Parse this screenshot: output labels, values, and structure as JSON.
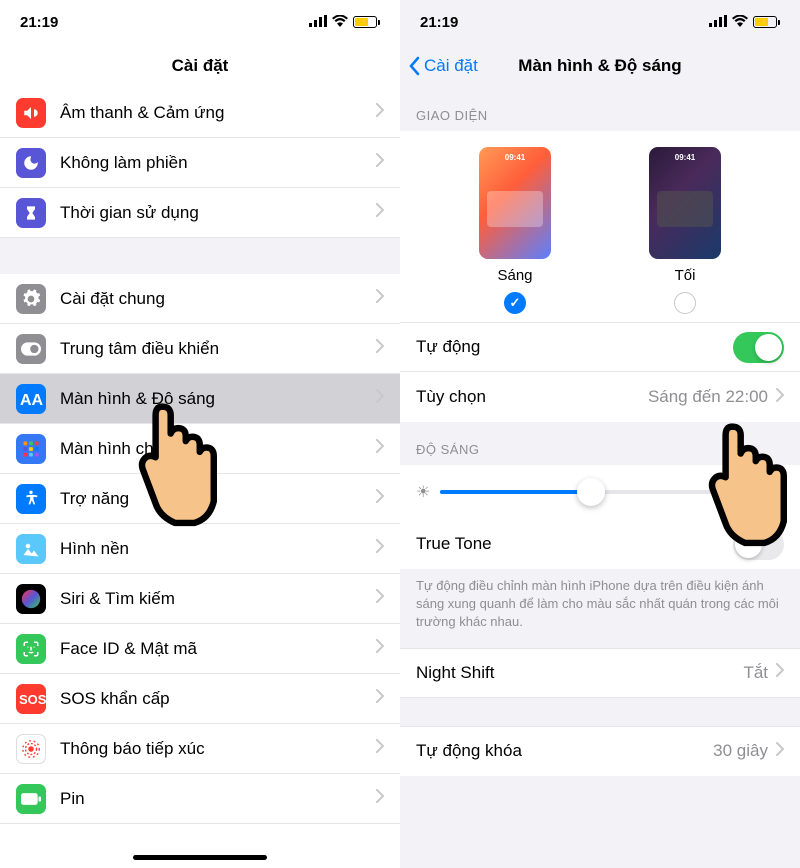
{
  "status": {
    "time": "21:19"
  },
  "left": {
    "title": "Cài đặt",
    "rows": [
      {
        "icon": "sound",
        "color": "#ff3b30",
        "label": "Âm thanh & Cảm ứng"
      },
      {
        "icon": "moon",
        "color": "#5856d6",
        "label": "Không làm phiền"
      },
      {
        "icon": "hourglass",
        "color": "#5856d6",
        "label": "Thời gian sử dụng"
      },
      {
        "icon": "gear",
        "color": "#8e8e93",
        "label": "Cài đặt chung"
      },
      {
        "icon": "toggle",
        "color": "#8e8e93",
        "label": "Trung tâm điều khiển"
      },
      {
        "icon": "aa",
        "color": "#007aff",
        "label": "Màn hình & Độ sáng",
        "selected": true
      },
      {
        "icon": "grid",
        "color": "#3478f6",
        "label": "Màn hình chính"
      },
      {
        "icon": "access",
        "color": "#007aff",
        "label": "Trợ năng"
      },
      {
        "icon": "wallpaper",
        "color": "#5ac8fa",
        "label": "Hình nền"
      },
      {
        "icon": "siri",
        "color": "#000",
        "label": "Siri & Tìm kiếm"
      },
      {
        "icon": "faceid",
        "color": "#34c759",
        "label": "Face ID & Mật mã"
      },
      {
        "icon": "sos",
        "color": "#ff3b30",
        "label": "SOS khẩn cấp"
      },
      {
        "icon": "exposure",
        "color": "#fff",
        "label": "Thông báo tiếp xúc"
      },
      {
        "icon": "battery",
        "color": "#34c759",
        "label": "Pin"
      }
    ]
  },
  "right": {
    "back": "Cài đặt",
    "title": "Màn hình & Độ sáng",
    "appearance_header": "GIAO DIỆN",
    "light_label": "Sáng",
    "dark_label": "Tối",
    "preview_time": "09:41",
    "auto_label": "Tự động",
    "options_label": "Tùy chọn",
    "options_value": "Sáng đến 22:00",
    "brightness_header": "ĐỘ SÁNG",
    "truetone_label": "True Tone",
    "truetone_footer": "Tự động điều chỉnh màn hình iPhone dựa trên điều kiện ánh sáng xung quanh để làm cho màu sắc nhất quán trong các môi trường khác nhau.",
    "nightshift_label": "Night Shift",
    "nightshift_value": "Tắt",
    "autolock_label": "Tự động khóa",
    "autolock_value": "30 giây"
  }
}
